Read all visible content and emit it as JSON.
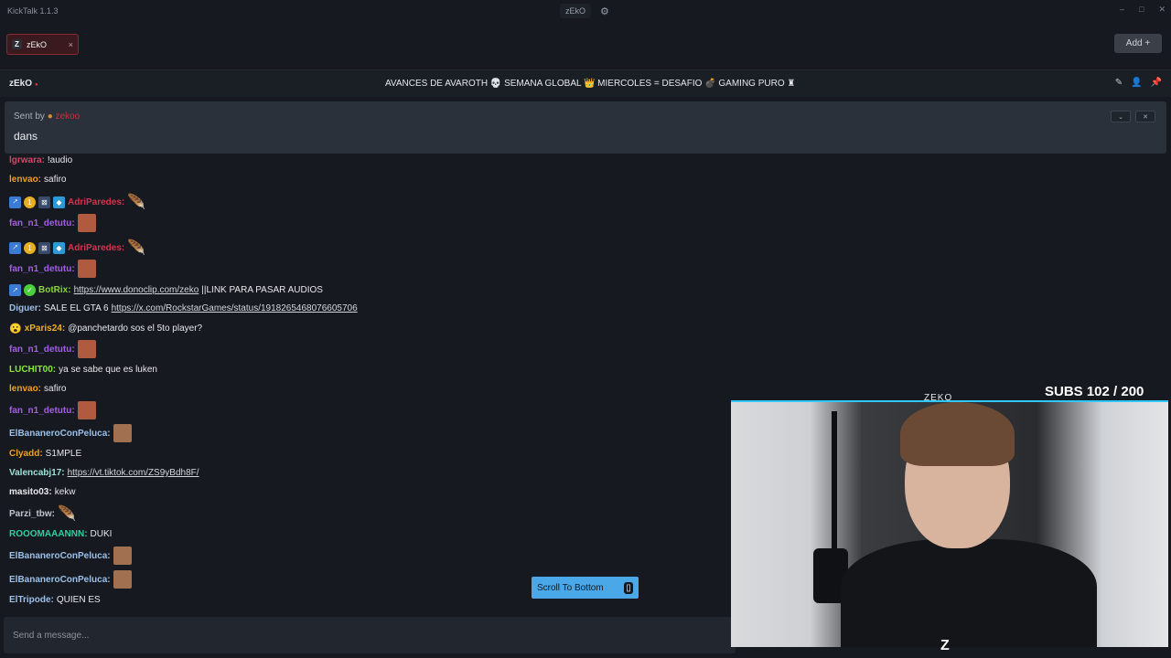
{
  "app": {
    "title": "KickTalk 1.1.3",
    "window_center_label": "zEkO"
  },
  "window_controls": [
    "–",
    "□",
    "✕"
  ],
  "tabs": [
    {
      "label": "zEkO",
      "close": "×"
    }
  ],
  "add_button": {
    "label": "Add +"
  },
  "channel": {
    "name": "zEkO",
    "stream_title": "AVANCES DE AVAROTH 💀 SEMANA GLOBAL 👑 MIERCOLES = DESAFIO 💣 GAMING PURO ♜"
  },
  "pinned": {
    "sent_by_label": "Sent by",
    "sender": "zekoo",
    "message": "dans"
  },
  "messages": [
    {
      "user": "lgrwara:",
      "color": "#e0406a",
      "text": "!audio"
    },
    {
      "user": "lenvao:",
      "color": "#f0a020",
      "text": "safiro"
    },
    {
      "user": "AdriParedes:",
      "color": "#d43350",
      "text": "",
      "badges": [
        "pin-badge",
        "coin-badge",
        "shield-badge",
        "gem-badge"
      ],
      "emote": "feather"
    },
    {
      "user": "fan_n1_detutu:",
      "color": "#a55ee8",
      "text": "",
      "emote": "face"
    },
    {
      "user": "AdriParedes:",
      "color": "#d43350",
      "text": "",
      "badges": [
        "pin-badge",
        "coin-badge",
        "shield-badge",
        "gem-badge"
      ],
      "emote": "feather"
    },
    {
      "user": "fan_n1_detutu:",
      "color": "#a55ee8",
      "text": "",
      "emote": "face"
    },
    {
      "user": "BotRix:",
      "color": "#8ad53a",
      "link": "https://www.donoclip.com/zeko",
      "text": " ||LINK PARA PASAR AUDIOS",
      "badges": [
        "pin-badge",
        "bot-badge"
      ]
    },
    {
      "user": "Diguer:",
      "color": "#9cc0e8",
      "text": "SALE EL GTA 6",
      "link": "https://x.com/RockstarGames/status/1918265468076605706"
    },
    {
      "user": "xParis24:",
      "color": "#f0b020",
      "text": "@panchetardo sos el 5to player?",
      "badges": [
        "emoji-badge"
      ]
    },
    {
      "user": "fan_n1_detutu:",
      "color": "#a55ee8",
      "text": "",
      "emote": "face"
    },
    {
      "user": "LUCHIT00:",
      "color": "#8ae830",
      "text": "ya se sabe que es luken"
    },
    {
      "user": "lenvao:",
      "color": "#f0a020",
      "text": "safiro"
    },
    {
      "user": "fan_n1_detutu:",
      "color": "#a55ee8",
      "text": "",
      "emote": "face"
    },
    {
      "user": "ElBananeroConPeluca:",
      "color": "#9cc0e8",
      "text": "",
      "emote": "photo"
    },
    {
      "user": "Clyadd:",
      "color": "#f0a020",
      "text": "S1MPLE"
    },
    {
      "user": "Valencabj17:",
      "color": "#9ce0d8",
      "text": "",
      "link": "https://vt.tiktok.com/ZS9yBdh8F/"
    },
    {
      "user": "masito03:",
      "color": "#e6e8ec",
      "text": "kekw"
    },
    {
      "user": "Parzi_tbw:",
      "color": "#c0c4cc",
      "text": "",
      "emote": "feather"
    },
    {
      "user": "ROOOMAAANNN:",
      "color": "#2ed0a0",
      "text": "DUKI"
    },
    {
      "user": "ElBananeroConPeluca:",
      "color": "#9cc0e8",
      "text": "",
      "emote": "photo"
    },
    {
      "user": "ElBananeroConPeluca:",
      "color": "#9cc0e8",
      "text": "",
      "emote": "photo"
    },
    {
      "user": "ElTripode:",
      "color": "#9cc0e8",
      "text": "QUIEN ES"
    }
  ],
  "scroll_button": {
    "label": "Scroll To Bottom"
  },
  "input": {
    "placeholder": "Send a message..."
  },
  "overlay": {
    "subs": "SUBS 102 / 200",
    "cam_label": "ZEKO"
  }
}
